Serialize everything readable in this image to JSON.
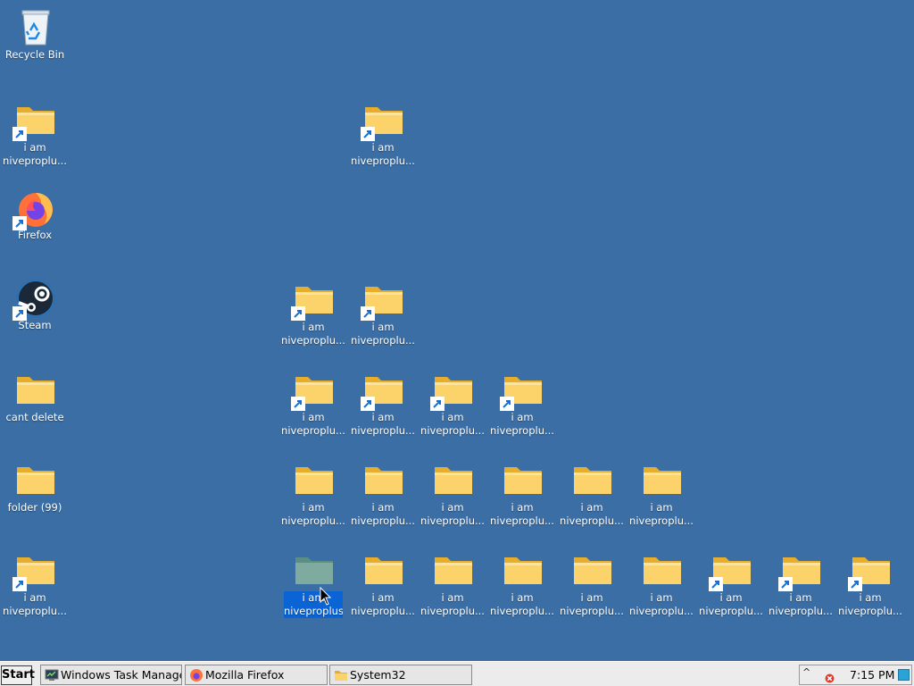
{
  "desktop": {
    "recycle_bin": "Recycle Bin",
    "folder_shortcut_1": "i am\nniveproplu...",
    "folder_shortcut_2": "i am\nniveproplu...",
    "firefox": "Firefox",
    "steam": "Steam",
    "cant_delete": "cant delete",
    "folder_99": "folder (99)",
    "folder_shortcut_3": "i am\nniveproplu...",
    "row4": [
      "i am\nniveproplu...",
      "i am\nniveproplu..."
    ],
    "row5": [
      "i am\nniveproplu...",
      "i am\nniveproplu...",
      "i am\nniveproplu...",
      "i am\nniveproplu..."
    ],
    "row6": [
      "i am\nniveproplu...",
      "i am\nniveproplu...",
      "i am\nniveproplu...",
      "i am\nniveproplu...",
      "i am\nniveproplu...",
      "i am\nniveproplu..."
    ],
    "row7": [
      "i am\nniveproplus",
      "i am\nniveproplu...",
      "i am\nniveproplu...",
      "i am\nniveproplu...",
      "i am\nniveproplu...",
      "i am\nniveproplu...",
      "i am\nniveproplu...",
      "i am\nniveproplu...",
      "i am\nniveproplu..."
    ]
  },
  "taskbar": {
    "start": "Start",
    "tasks": [
      "Windows Task Manager",
      "Mozilla Firefox",
      "System32"
    ],
    "tray": {
      "chevron": "^",
      "clock": "7:15 PM"
    }
  },
  "colors": {
    "desktop": "#3a6ea5",
    "selection": "#0a64d6",
    "folder": "#f5c84a"
  }
}
